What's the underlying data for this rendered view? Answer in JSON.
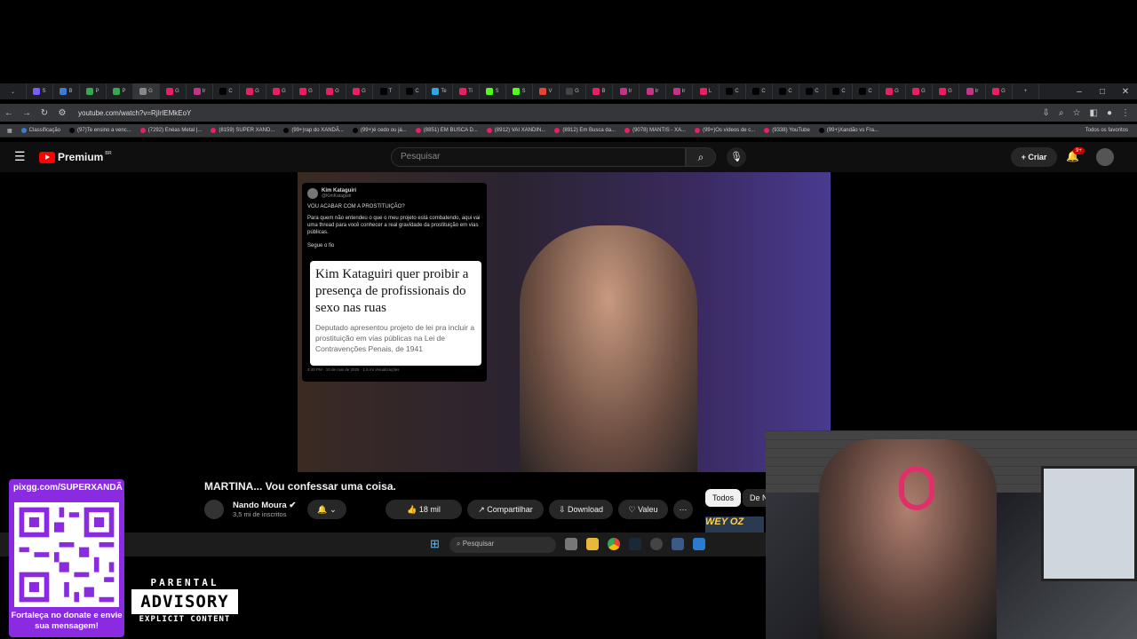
{
  "browser": {
    "tabs": [
      "S",
      "B",
      "P",
      "P",
      "G",
      "G",
      "Ir",
      "C",
      "G",
      "G",
      "G",
      "G",
      "G",
      "T",
      "C",
      "Te",
      "Ti",
      "S",
      "S",
      "V",
      "G",
      "B",
      "Ir",
      "Ir",
      "Ir",
      "L",
      "C",
      "C",
      "C",
      "C",
      "C",
      "C",
      "G",
      "G",
      "G",
      "Ir",
      "G"
    ],
    "url": "youtube.com/watch?v=RjIrlEMkEoY",
    "bookmarks": [
      "Classificação",
      "(97)Te ensino a venc...",
      "(7292) Enéas Metal |...",
      "(8159) SUPER XAND...",
      "(99+)rap do XANDÃ...",
      "(99+)é cedo ou já...",
      "(8851) EM BUSCA D...",
      "(8912) VAI XANDIN...",
      "(8912) Em Busca da...",
      "(9078) MANTIS - XA...",
      "(99+)Os vídeos de c...",
      "(9338) YouTube",
      "(99+)Xandão vs Fra..."
    ],
    "all_favorites": "Todos os favoritos"
  },
  "youtube": {
    "brand": "Premium",
    "region": "BR",
    "search_placeholder": "Pesquisar",
    "create_label": "Criar",
    "notif_count": "9+",
    "video": {
      "tweet_name": "Kim Kataguiri",
      "tweet_handle": "@KimKataguiri",
      "tweet_text1": "VOU ACABAR COM A PROSTITUIÇÃO?",
      "tweet_text2": "Para quem não entendeu o que o meu projeto está combatendo, aqui vai uma thread para você conhecer a real gravidade da prostituição em vias públicas.",
      "tweet_text3": "Segue o fio",
      "card_headline": "Kim Kataguiri quer proibir a presença de profissionais do sexo nas ruas",
      "card_sub": "Deputado apresentou projeto de lei pra incluir a prostituição em vias públicas na Lei de Contravenções Penais, de 1941",
      "tweet_meta": "3:40 PM · 10 de mar de 2025 · 1,5 mi Visualizações"
    },
    "title": "MARTINA... Vou confessar uma coisa.",
    "channel": "Nando Moura",
    "subs": "3,5 mi de inscritos",
    "likes": "18 mil",
    "share": "Compartilhar",
    "download": "Download",
    "thanks": "Valeu",
    "chip_all": "Todos",
    "chip_next": "De N",
    "thumb_text": "WEY OZ"
  },
  "taskbar": {
    "search": "Pesquisar"
  },
  "overlay": {
    "pix": "pixgg.com/SUPERXANDÃ",
    "donate": "Fortaleça no donate e envie sua mensagem!",
    "pa_top": "PARENTAL",
    "pa_mid": "ADVISORY",
    "pa_bot": "EXPLICIT CONTENT"
  },
  "colors": {
    "yt_red": "#ff0000",
    "purple": "#8a2be2"
  }
}
